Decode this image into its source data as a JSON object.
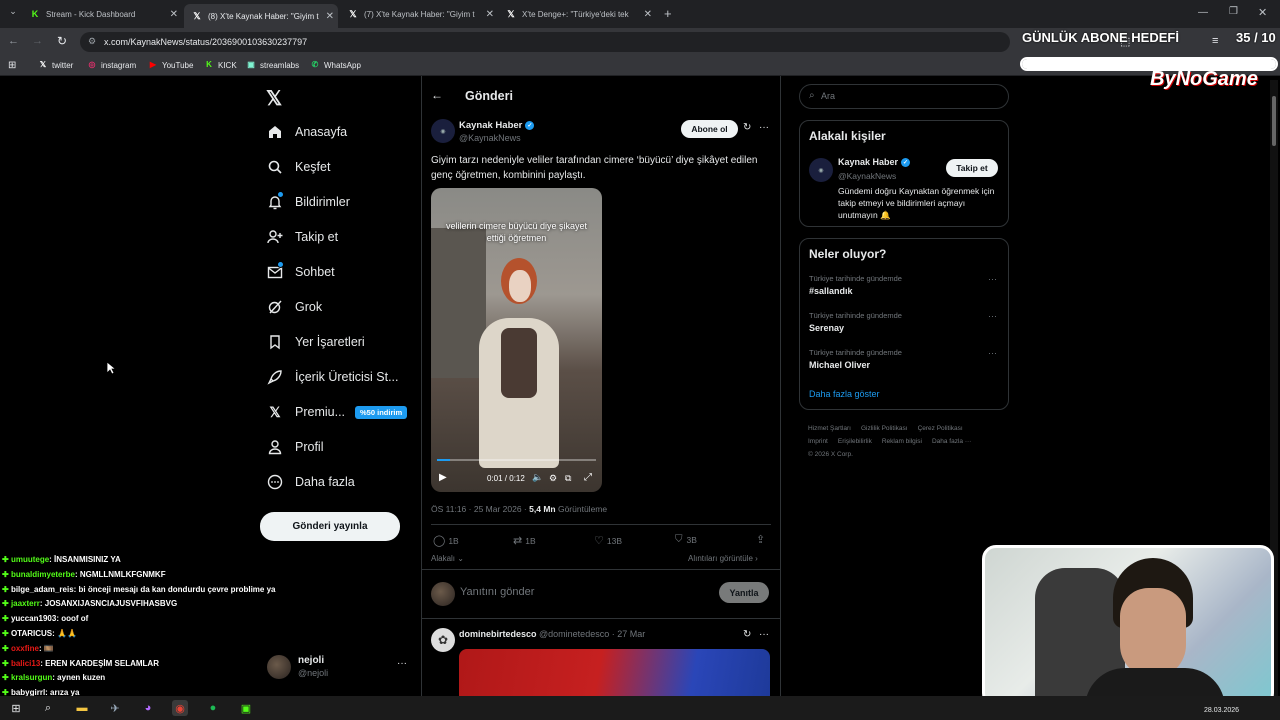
{
  "tabs": [
    {
      "title": "Stream - Kick Dashboard"
    },
    {
      "title": "(8) X'te Kaynak Haber: \"Giyim t"
    },
    {
      "title": "(7) X'te Kaynak Haber: \"Giyim t"
    },
    {
      "title": "X'te Denge+: \"Türkiye'deki tek"
    }
  ],
  "address": {
    "url": "x.com/KaynakNews/status/2036900103630237797"
  },
  "bookmarks": [
    "twitter",
    "instagram",
    "YouTube",
    "KICK",
    "streamlabs",
    "WhatsApp"
  ],
  "overlay": {
    "goal_title": "GÜNLÜK ABONE HEDEFİ",
    "goal_count": "35 / 10",
    "goal_progress": 1.0,
    "brand": "ByNoGame"
  },
  "nav": {
    "items": [
      "Anasayfa",
      "Keşfet",
      "Bildirimler",
      "Takip et",
      "Sohbet",
      "Grok",
      "Yer İşaretleri",
      "İçerik Üreticisi St...",
      "Premiu...",
      "Profil",
      "Daha fazla"
    ],
    "premium_badge": "%50 indirim",
    "post_button": "Gönderi yayınla",
    "account_name": "nejoli",
    "account_handle": "@nejoli",
    "account_more": "···"
  },
  "post": {
    "header": "Gönderi",
    "author": "Kaynak Haber",
    "handle": "@KaynakNews",
    "subscribe": "Abone ol",
    "more": "···",
    "text": "Giyim tarzı nedeniyle veliler tarafından cimere ‘büyücü’ diye şikâyet edilen genç öğretmen, kombinini paylaştı.",
    "video_caption": "velilerin cimere büyücü diye şikayet ettiği öğretmen",
    "video_time": "0:01 / 0:12",
    "video_progress": 0.08,
    "time": "ÖS 11:16 · 25 Mar 2026 ·",
    "views_value": "5,4 Mn",
    "views_label": "Görüntüleme",
    "replies": "1B",
    "reposts": "1B",
    "likes": "13B",
    "bookmarks": "3B",
    "relevant": "Alakalı",
    "quotes": "Alıntıları görüntüle ›",
    "reply_placeholder": "Yanıtını gönder",
    "reply_button": "Yanıtla"
  },
  "reply": {
    "author": "dominebirtedesco",
    "handle": "@dominetedesco · 27 Mar",
    "more": "···"
  },
  "search": {
    "placeholder": "Ara"
  },
  "relevant_people": {
    "title": "Alakalı kişiler",
    "name": "Kaynak Haber",
    "handle": "@KaynakNews",
    "follow": "Takip et",
    "bio": "Gündemi doğru Kaynaktan öğrenmek için takip etmeyi ve bildirimleri açmayı unutmayın 🔔"
  },
  "trends": {
    "title": "Neler oluyor?",
    "items": [
      {
        "context": "Türkiye tarihinde gündemde",
        "name": "#sallandık"
      },
      {
        "context": "Türkiye tarihinde gündemde",
        "name": "Serenay"
      },
      {
        "context": "Türkiye tarihinde gündemde",
        "name": "Michael Oliver"
      }
    ],
    "more": "Daha fazla göster"
  },
  "footer": {
    "line1": [
      "Hizmet Şartları",
      "Gizlilik Politikası",
      "Çerez Politikası"
    ],
    "line2": [
      "Imprint",
      "Erişilebilirlik",
      "Reklam bilgisi",
      "Daha fazla ···"
    ],
    "copyright": "© 2026 X Corp."
  },
  "chat": [
    {
      "user": "umuutege",
      "msg": ": İNSANMISINIZ YA",
      "color": "#53fc18"
    },
    {
      "user": "bunaldimyeterbe",
      "msg": ": NGMLLNMLKFGNMKF",
      "color": "#53fc18"
    },
    {
      "user": "bilge_adam_reis",
      "msg": ": bi önceji mesajı da kan dondurdu çevre problime ya",
      "color": "#ffffff"
    },
    {
      "user": "jaaxterr",
      "msg": ": JOSANXIJASNCIAJUSVFIHASBVG",
      "color": "#53fc18"
    },
    {
      "user": "yuccan1903",
      "msg": ": ooof of",
      "color": "#ffffff"
    },
    {
      "user": "OTARICUS",
      "msg": ": 🙏🙏",
      "color": "#ffffff"
    },
    {
      "user": "oxxfine",
      "msg": ": 🎞️",
      "color": "#e91916"
    },
    {
      "user": "balici13",
      "msg": ": EREN KARDEŞİM SELAMLAR",
      "color": "#e91916"
    },
    {
      "user": "kralsurgun",
      "msg": ": aynen kuzen",
      "color": "#53fc18"
    },
    {
      "user": "babygirrl",
      "msg": ": arıza ya",
      "color": "#ffffff"
    }
  ],
  "taskbar": {
    "date": "28.03.2026"
  }
}
